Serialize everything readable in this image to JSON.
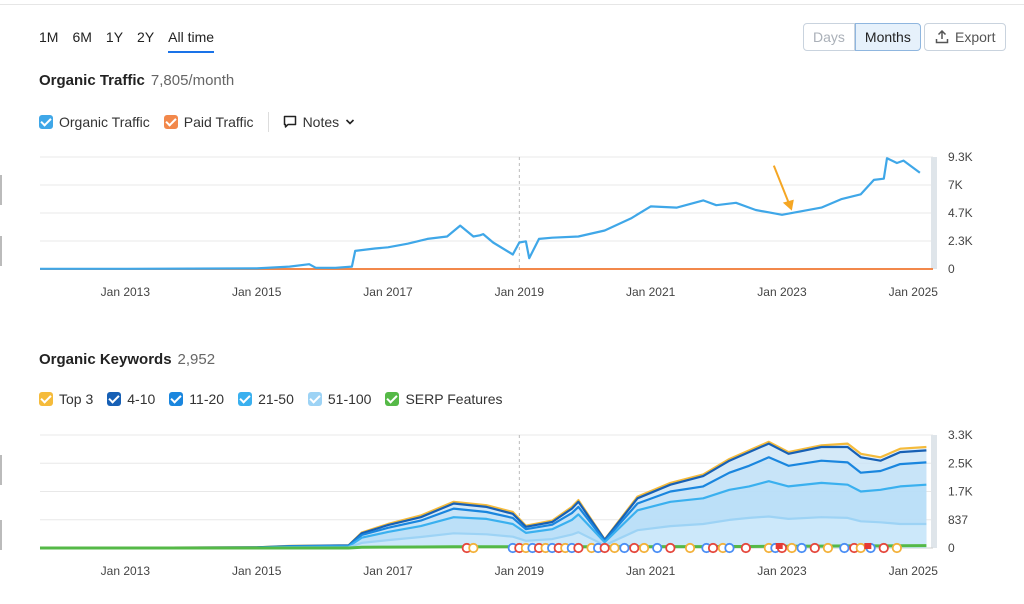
{
  "ranges": [
    {
      "label": "1M",
      "active": false
    },
    {
      "label": "6M",
      "active": false
    },
    {
      "label": "1Y",
      "active": false
    },
    {
      "label": "2Y",
      "active": false
    },
    {
      "label": "All time",
      "active": true
    }
  ],
  "granularity": {
    "days": "Days",
    "months": "Months",
    "selected": "Months"
  },
  "export_label": "Export",
  "traffic": {
    "title": "Organic Traffic",
    "value": "7,805/month",
    "legend": [
      {
        "label": "Organic Traffic",
        "color": "#3fa7e8",
        "checked": true
      },
      {
        "label": "Paid Traffic",
        "color": "#f2884b",
        "checked": true
      }
    ],
    "notes_label": "Notes"
  },
  "keywords": {
    "title": "Organic Keywords",
    "value": "2,952",
    "legend": [
      {
        "label": "Top 3",
        "color": "#f5bb3b",
        "checked": true
      },
      {
        "label": "4-10",
        "color": "#1760b5",
        "checked": true
      },
      {
        "label": "11-20",
        "color": "#1a86de",
        "checked": true
      },
      {
        "label": "21-50",
        "color": "#3ab0ef",
        "checked": true
      },
      {
        "label": "51-100",
        "color": "#9dd3f5",
        "checked": true
      },
      {
        "label": "SERP Features",
        "color": "#55b947",
        "checked": true
      }
    ]
  },
  "chart_data": [
    {
      "type": "line",
      "title": "Organic Traffic",
      "x_ticks": [
        "Jan 2013",
        "Jan 2015",
        "Jan 2017",
        "Jan 2019",
        "Jan 2021",
        "Jan 2023",
        "Jan 2025"
      ],
      "y_ticks": [
        "9.3K",
        "7K",
        "4.7K",
        "2.3K",
        "0"
      ],
      "ylim": [
        0,
        9300
      ],
      "xlim": [
        2011.7,
        2025.3
      ],
      "series": [
        {
          "name": "Organic Traffic",
          "color": "#3fa7e8",
          "x": [
            2011.7,
            2013.0,
            2014.0,
            2015.0,
            2015.5,
            2015.8,
            2015.9,
            2016.2,
            2016.45,
            2016.5,
            2016.8,
            2017.0,
            2017.3,
            2017.6,
            2017.9,
            2018.1,
            2018.3,
            2018.4,
            2018.45,
            2018.6,
            2018.9,
            2019.0,
            2019.1,
            2019.15,
            2019.3,
            2019.5,
            2019.9,
            2020.3,
            2020.7,
            2021.0,
            2021.4,
            2021.8,
            2022.0,
            2022.3,
            2022.6,
            2022.9,
            2023.0,
            2023.3,
            2023.6,
            2023.9,
            2024.2,
            2024.4,
            2024.55,
            2024.6,
            2024.75,
            2024.85,
            2025.1
          ],
          "y": [
            20,
            20,
            30,
            50,
            200,
            400,
            100,
            100,
            200,
            1500,
            1700,
            1800,
            2100,
            2500,
            2700,
            3600,
            2700,
            2800,
            2900,
            2200,
            1200,
            2200,
            2300,
            900,
            2500,
            2600,
            2700,
            3200,
            4200,
            5200,
            5100,
            5700,
            5300,
            5500,
            4900,
            4600,
            4500,
            4800,
            5100,
            5800,
            6200,
            7400,
            7500,
            9200,
            8800,
            9000,
            8000
          ]
        },
        {
          "name": "Paid Traffic",
          "color": "#f2884b",
          "x": [
            2011.7,
            2025.3
          ],
          "y": [
            0,
            0
          ]
        }
      ]
    },
    {
      "type": "area",
      "title": "Organic Keywords",
      "x_ticks": [
        "Jan 2013",
        "Jan 2015",
        "Jan 2017",
        "Jan 2019",
        "Jan 2021",
        "Jan 2023",
        "Jan 2025"
      ],
      "y_ticks": [
        "3.3K",
        "2.5K",
        "1.7K",
        "837",
        "0"
      ],
      "ylim": [
        0,
        3300
      ],
      "xlim": [
        2011.7,
        2025.3
      ],
      "x": [
        2011.7,
        2013.0,
        2015.0,
        2015.5,
        2016.4,
        2016.6,
        2017.0,
        2017.5,
        2018.0,
        2018.5,
        2018.9,
        2019.1,
        2019.5,
        2019.8,
        2019.9,
        2020.3,
        2020.8,
        2021.3,
        2021.8,
        2022.2,
        2022.5,
        2022.8,
        2023.1,
        2023.6,
        2024.0,
        2024.2,
        2024.5,
        2024.8,
        2025.2
      ],
      "series": [
        {
          "name": "Top 3",
          "color": "#f5bb3b",
          "values": [
            0,
            10,
            20,
            60,
            80,
            450,
            700,
            950,
            1350,
            1250,
            1050,
            650,
            800,
            1200,
            1400,
            250,
            1500,
            1900,
            2150,
            2600,
            2850,
            3100,
            2800,
            3000,
            3050,
            2750,
            2650,
            2900,
            2950
          ]
        },
        {
          "name": "4-10",
          "color": "#1760b5",
          "values": [
            0,
            10,
            20,
            55,
            75,
            430,
            670,
            900,
            1300,
            1200,
            1000,
            620,
            760,
            1150,
            1350,
            240,
            1450,
            1850,
            2100,
            2550,
            2800,
            3050,
            2750,
            2950,
            2950,
            2650,
            2550,
            2800,
            2850
          ]
        },
        {
          "name": "11-20",
          "color": "#1a86de",
          "values": [
            0,
            8,
            15,
            45,
            60,
            380,
            590,
            800,
            1150,
            1050,
            880,
            550,
            680,
            1020,
            1200,
            210,
            1300,
            1650,
            1800,
            2200,
            2400,
            2650,
            2400,
            2550,
            2500,
            2200,
            2250,
            2450,
            2500
          ]
        },
        {
          "name": "21-50",
          "color": "#3ab0ef",
          "values": [
            0,
            6,
            12,
            35,
            45,
            300,
            470,
            640,
            900,
            850,
            700,
            440,
            550,
            820,
            980,
            170,
            1100,
            1350,
            1450,
            1700,
            1800,
            1950,
            1800,
            1900,
            1850,
            1650,
            1700,
            1800,
            1850
          ]
        },
        {
          "name": "51-100",
          "color": "#9dd3f5",
          "values": [
            0,
            3,
            5,
            15,
            20,
            150,
            230,
            320,
            430,
            400,
            330,
            210,
            260,
            390,
            460,
            80,
            520,
            640,
            700,
            820,
            880,
            920,
            850,
            900,
            880,
            780,
            750,
            700,
            700
          ]
        },
        {
          "name": "SERP Features",
          "color": "#55b947",
          "values": [
            0,
            0,
            0,
            0,
            0,
            20,
            25,
            30,
            35,
            35,
            35,
            35,
            35,
            35,
            35,
            35,
            35,
            40,
            40,
            45,
            45,
            50,
            50,
            55,
            60,
            60,
            60,
            65,
            70
          ]
        }
      ],
      "serp_markers_x": [
        2018.2,
        2018.3,
        2018.9,
        2019.0,
        2019.1,
        2019.2,
        2019.3,
        2019.4,
        2019.5,
        2019.6,
        2019.7,
        2019.8,
        2019.9,
        2020.1,
        2020.2,
        2020.3,
        2020.45,
        2020.6,
        2020.75,
        2020.9,
        2021.1,
        2021.3,
        2021.6,
        2021.85,
        2021.95,
        2022.1,
        2022.2,
        2022.45,
        2022.8,
        2022.9,
        2023.0,
        2023.15,
        2023.3,
        2023.5,
        2023.7,
        2023.95,
        2024.1,
        2024.2,
        2024.35,
        2024.55,
        2024.75
      ]
    }
  ]
}
